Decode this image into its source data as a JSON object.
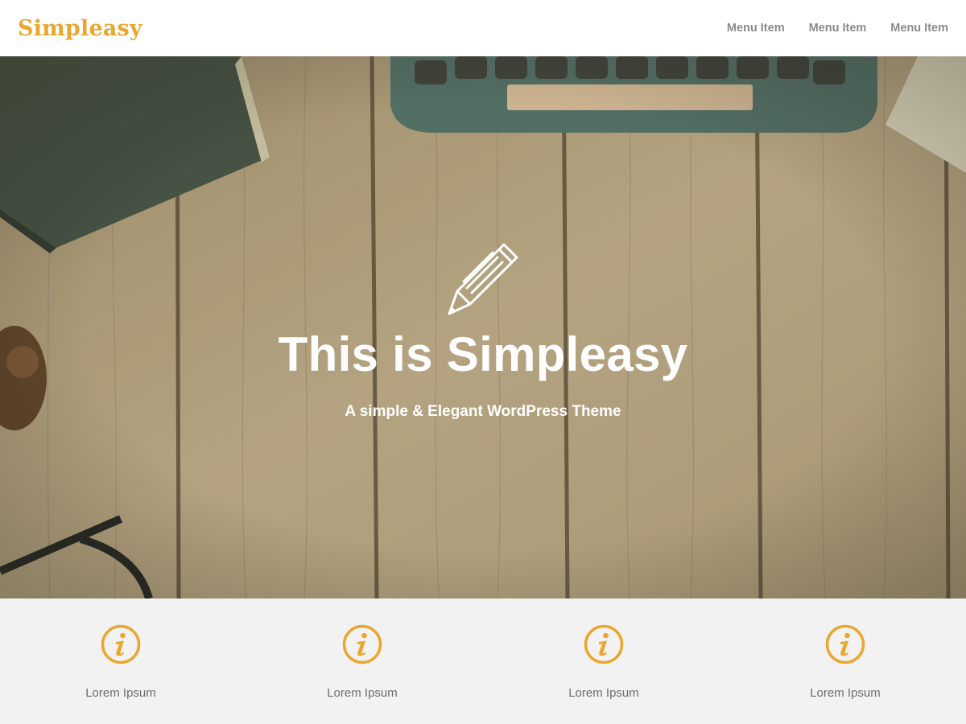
{
  "header": {
    "brand": "Simpleasy",
    "nav": [
      {
        "label": "Menu Item"
      },
      {
        "label": "Menu Item"
      },
      {
        "label": "Menu Item"
      }
    ]
  },
  "hero": {
    "icon": "pencil-icon",
    "title": "This is Simpleasy",
    "subtitle": "A simple & Elegant WordPress Theme"
  },
  "features": [
    {
      "icon": "info-icon",
      "label": "Lorem Ipsum"
    },
    {
      "icon": "info-icon",
      "label": "Lorem Ipsum"
    },
    {
      "icon": "info-icon",
      "label": "Lorem Ipsum"
    },
    {
      "icon": "info-icon",
      "label": "Lorem Ipsum"
    }
  ],
  "colors": {
    "accent": "#e9a730",
    "nav_text": "#8a8a8a",
    "features_bg": "#f2f2f2",
    "feature_text": "#6d6d6d"
  }
}
